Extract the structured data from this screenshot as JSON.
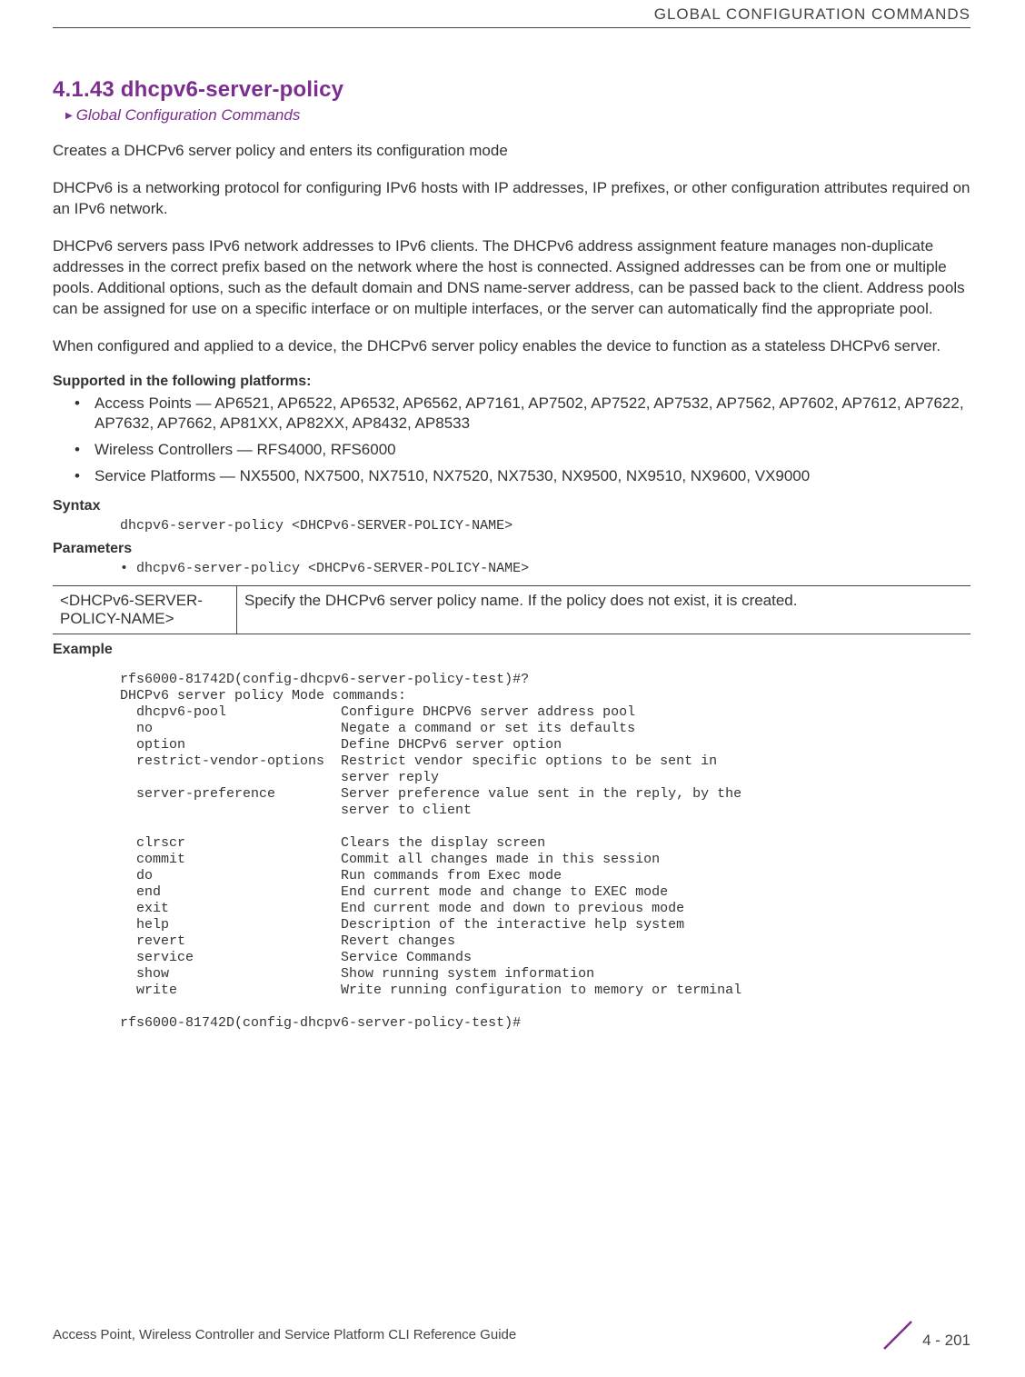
{
  "header": {
    "running_title": "GLOBAL CONFIGURATION COMMANDS"
  },
  "section": {
    "number_title": "4.1.43 dhcpv6-server-policy",
    "subref": "Global Configuration Commands",
    "p1": "Creates a DHCPv6 server policy and enters its configuration mode",
    "p2": "DHCPv6 is a networking protocol for configuring IPv6 hosts with IP addresses, IP prefixes, or other configuration attributes required on an IPv6 network.",
    "p3": "DHCPv6 servers pass IPv6 network addresses to IPv6 clients. The DHCPv6 address assignment feature manages non-duplicate addresses in the correct prefix based on the network where the host is connected. Assigned addresses can be from one or multiple pools. Additional options, such as the default domain and DNS name-server address, can be passed back to the client. Address pools can be assigned for use on a specific interface or on multiple interfaces, or the server can automatically find the appropriate pool.",
    "p4": "When configured and applied to a device, the DHCPv6 server policy enables the device to function as a stateless DHCPv6 server."
  },
  "supported": {
    "heading": "Supported in the following platforms:",
    "items": [
      "Access Points — AP6521, AP6522, AP6532, AP6562, AP7161, AP7502, AP7522, AP7532, AP7562, AP7602, AP7612, AP7622, AP7632, AP7662, AP81XX, AP82XX, AP8432, AP8533",
      "Wireless Controllers — RFS4000, RFS6000",
      "Service Platforms — NX5500, NX7500, NX7510, NX7520, NX7530, NX9500, NX9510, NX9600, VX9000"
    ]
  },
  "syntax": {
    "heading": "Syntax",
    "line": "dhcpv6-server-policy <DHCPv6-SERVER-POLICY-NAME>"
  },
  "parameters": {
    "heading": "Parameters",
    "line": "dhcpv6-server-policy <DHCPv6-SERVER-POLICY-NAME>",
    "table": {
      "name": "<DHCPv6-SERVER-POLICY-NAME>",
      "desc": "Specify the DHCPv6 server policy name. If the policy does not exist, it is created."
    }
  },
  "example": {
    "heading": "Example",
    "text": "rfs6000-81742D(config-dhcpv6-server-policy-test)#?\nDHCPv6 server policy Mode commands:\n  dhcpv6-pool              Configure DHCPV6 server address pool\n  no                       Negate a command or set its defaults\n  option                   Define DHCPv6 server option\n  restrict-vendor-options  Restrict vendor specific options to be sent in\n                           server reply\n  server-preference        Server preference value sent in the reply, by the\n                           server to client\n\n  clrscr                   Clears the display screen\n  commit                   Commit all changes made in this session\n  do                       Run commands from Exec mode\n  end                      End current mode and change to EXEC mode\n  exit                     End current mode and down to previous mode\n  help                     Description of the interactive help system\n  revert                   Revert changes\n  service                  Service Commands\n  show                     Show running system information\n  write                    Write running configuration to memory or terminal\n\nrfs6000-81742D(config-dhcpv6-server-policy-test)#"
  },
  "footer": {
    "left": "Access Point, Wireless Controller and Service Platform CLI Reference Guide",
    "right": "4 - 201"
  }
}
